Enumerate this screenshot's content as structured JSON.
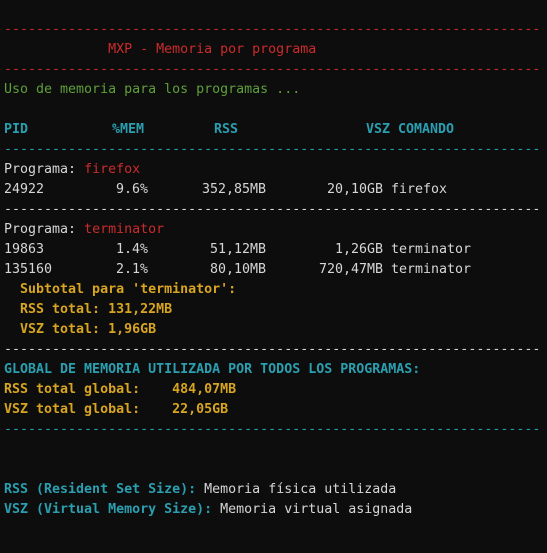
{
  "colors": {
    "red": "#cc2b2b",
    "green": "#5f9f3a",
    "cyan": "#2a9fb0",
    "yellow": "#d7a520",
    "text": "#d6d6d6",
    "background": "#0d0d0d"
  },
  "header": {
    "separator": "-------------------------------------------------------------------",
    "title": "             MXP - Memoria por programa",
    "subtitle": "Uso de memoria para los programas ..."
  },
  "table": {
    "columns": [
      "PID",
      "%MEM",
      "RSS",
      "VSZ",
      "COMANDO"
    ],
    "separator": "-------------------------------------------------------------------"
  },
  "programs": [
    {
      "label": "Programa: ",
      "name": "firefox",
      "rows": [
        {
          "pid": "24922",
          "mem": "9.6%",
          "rss": "352,85MB",
          "vsz": "20,10GB",
          "cmd": "firefox"
        }
      ]
    },
    {
      "label": "Programa: ",
      "name": "terminator",
      "rows": [
        {
          "pid": "19863",
          "mem": "1.4%",
          "rss": "51,12MB",
          "vsz": "1,26GB",
          "cmd": "terminator"
        },
        {
          "pid": "135160",
          "mem": "2.1%",
          "rss": "80,10MB",
          "vsz": "720,47MB",
          "cmd": "terminator"
        }
      ],
      "subtotal": {
        "title": "  Subtotal para 'terminator':",
        "rss": "  RSS total: 131,22MB",
        "vsz": "  VSZ total: 1,96GB"
      }
    }
  ],
  "global": {
    "title": "GLOBAL DE MEMORIA UTILIZADA POR TODOS LOS PROGRAMAS:",
    "rss": "RSS total global:    484,07MB",
    "vsz": "VSZ total global:    22,05GB"
  },
  "legend": [
    {
      "term": "RSS (Resident Set Size):",
      "desc": " Memoria física utilizada"
    },
    {
      "term": "VSZ (Virtual Memory Size):",
      "desc": " Memoria virtual asignada"
    }
  ]
}
